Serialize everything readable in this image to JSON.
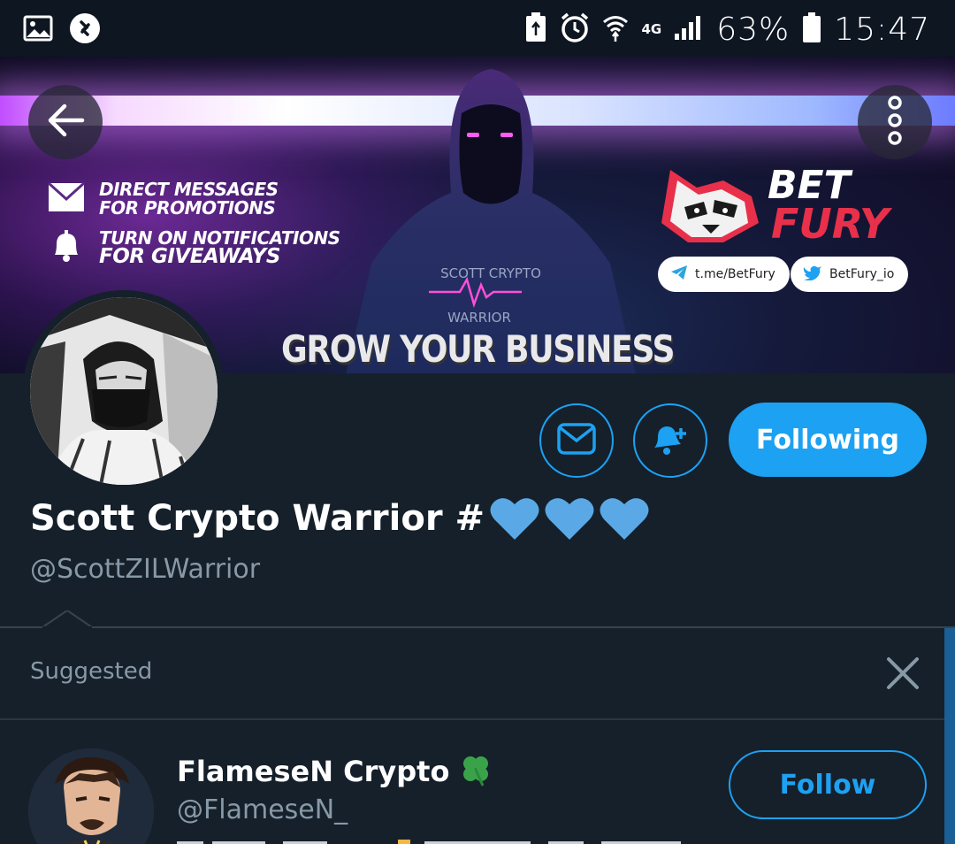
{
  "status_bar": {
    "time": "15:47",
    "battery_percent": "63%",
    "network": "4G",
    "icons": [
      "gallery-icon",
      "shazam-icon",
      "battery-saver-icon",
      "alarm-icon",
      "wifi-icon",
      "signal-icon",
      "battery-icon"
    ]
  },
  "banner": {
    "promo_line_1a": "DIRECT MESSAGES",
    "promo_line_1b": "FOR PROMOTIONS",
    "promo_line_2a": "TURN ON NOTIFICATIONS",
    "promo_line_2b": "FOR GIVEAWAYS",
    "hoodie_text_1": "SCOTT CRYPTO",
    "hoodie_text_2": "WARRIOR",
    "headline": "GROW YOUR BUSINESS",
    "brand_1": "BET",
    "brand_2": "FURY",
    "telegram_link": "t.me/BetFury",
    "twitter_link": "BetFury_io"
  },
  "profile": {
    "display_name": "Scott Crypto Warrior #",
    "handle": "@ScottZILWarrior",
    "following_label": "Following",
    "accent_color": "#1da1f2"
  },
  "suggested": {
    "label": "Suggested",
    "accounts": [
      {
        "name": "FlameseN Crypto",
        "handle": "@FlameseN_",
        "follow_label": "Follow"
      }
    ]
  }
}
